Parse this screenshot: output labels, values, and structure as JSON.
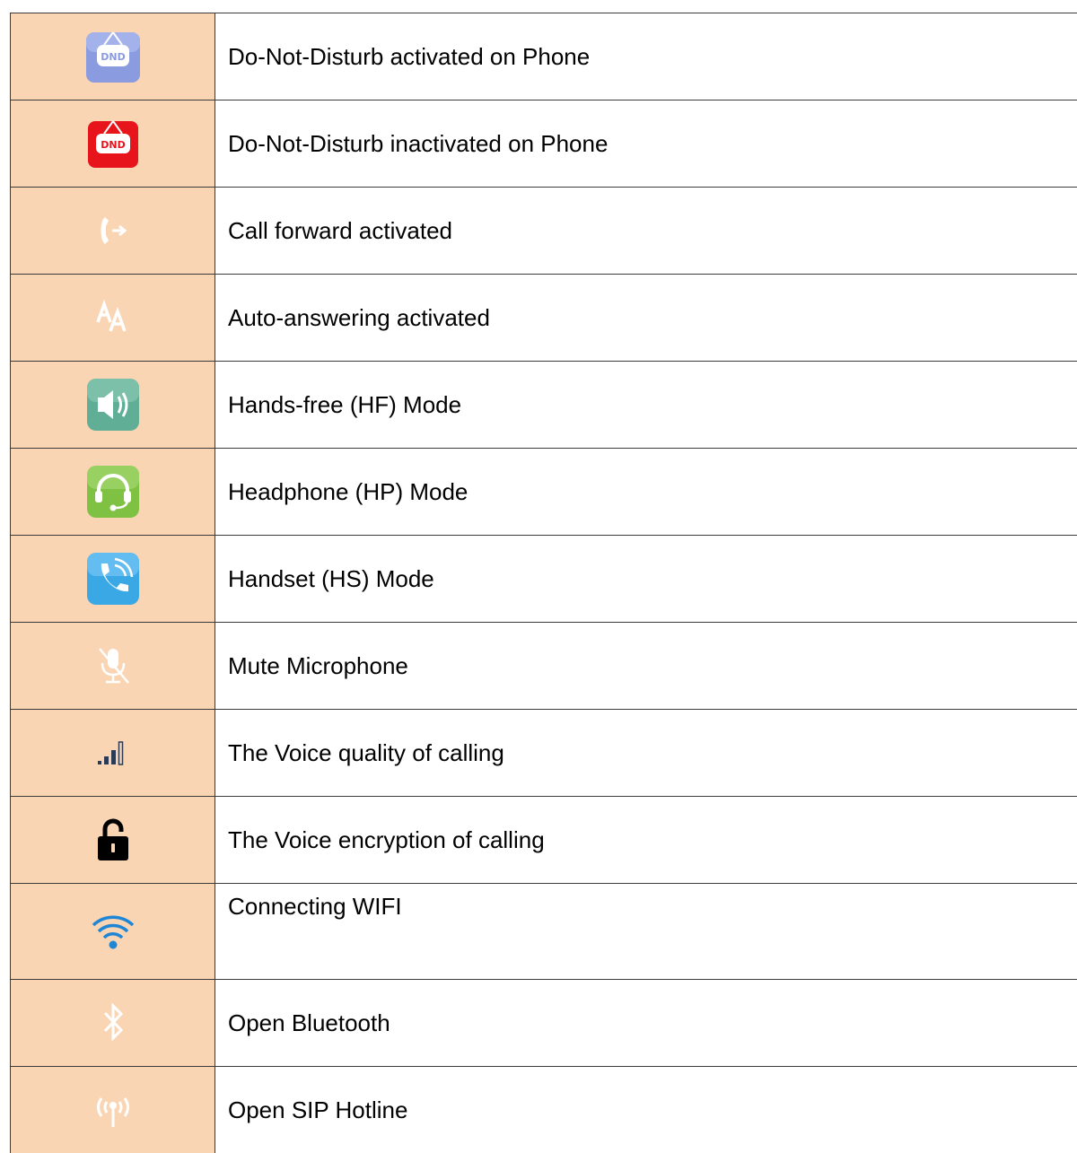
{
  "rows": [
    {
      "icon": "dnd-activated-icon",
      "icon_text": "DND",
      "description": "Do-Not-Disturb activated on Phone"
    },
    {
      "icon": "dnd-inactivated-icon",
      "icon_text": "DND",
      "description": "Do-Not-Disturb inactivated on Phone"
    },
    {
      "icon": "call-forward-icon",
      "description": "Call forward activated"
    },
    {
      "icon": "auto-answer-icon",
      "description": "Auto-answering activated"
    },
    {
      "icon": "speaker-icon",
      "description": "Hands-free (HF) Mode"
    },
    {
      "icon": "headset-icon",
      "description": "Headphone (HP) Mode"
    },
    {
      "icon": "handset-icon",
      "description": "Handset (HS) Mode"
    },
    {
      "icon": "mute-microphone-icon",
      "description": "Mute Microphone"
    },
    {
      "icon": "signal-bars-icon",
      "description": "The Voice quality of calling"
    },
    {
      "icon": "lock-icon",
      "description": "The Voice encryption of calling"
    },
    {
      "icon": "wifi-icon",
      "description": "Connecting WIFI"
    },
    {
      "icon": "bluetooth-icon",
      "description": "Open Bluetooth"
    },
    {
      "icon": "sip-hotline-icon",
      "description": "Open SIP Hotline"
    }
  ],
  "colors": {
    "icon_cell_background": "#fad5b4",
    "border": "#3a3a3a",
    "dnd_activated": "#8a9be0",
    "dnd_inactivated": "#e8141b",
    "speaker": "#5fae95",
    "headset": "#7fc243",
    "handset": "#3ba8e6",
    "wifi": "#1f86d6",
    "signal": "#2b3a55"
  }
}
